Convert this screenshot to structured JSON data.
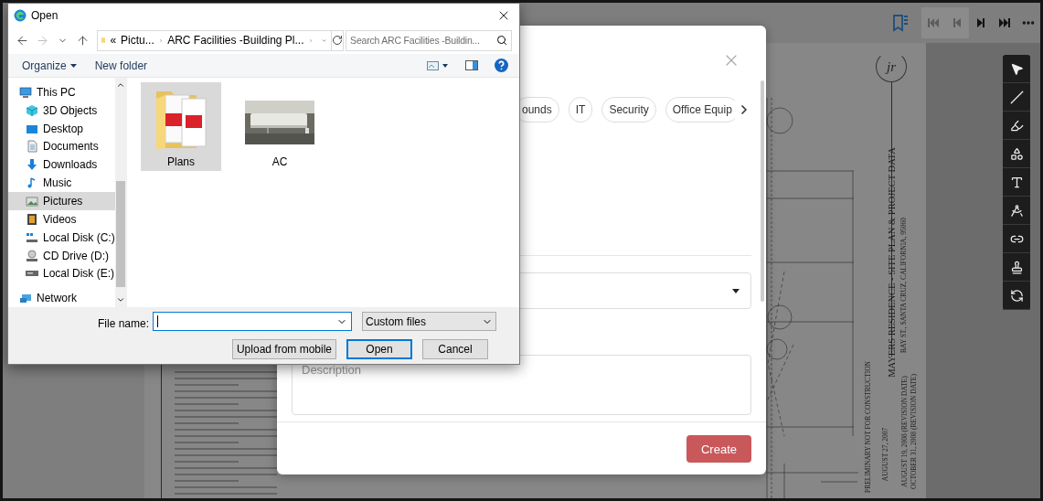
{
  "viewer": {
    "nav": [
      {
        "kind": "bookmarks",
        "disabled": false
      },
      {
        "kind": "first",
        "disabled": true
      },
      {
        "kind": "previous",
        "disabled": true
      },
      {
        "kind": "next",
        "disabled": false
      },
      {
        "kind": "last",
        "disabled": false
      },
      {
        "kind": "more",
        "disabled": false
      }
    ],
    "tools": [
      {
        "kind": "select"
      },
      {
        "kind": "line"
      },
      {
        "kind": "pen"
      },
      {
        "kind": "shapes"
      },
      {
        "kind": "text"
      },
      {
        "kind": "compass"
      },
      {
        "kind": "link"
      },
      {
        "kind": "stamp"
      },
      {
        "kind": "rotate"
      }
    ]
  },
  "sheet": {
    "logo": "jr",
    "title": "MAYERS RESIDENCE - SITE PLAN & PROJECT DATA",
    "subtitle": "BAY ST., SANTA CRUZ, CALIFORNIA, 95060",
    "stamp": "PRELIMINARY NOT FOR CONSTRUCTION",
    "date": "AUGUST 27, 2007",
    "revisions": [
      "AUGUST 19, 2008 (REVISION DATE)",
      "OCTOBER 31, 2008 (REVISION DATE)"
    ]
  },
  "modal": {
    "categories": [
      {
        "label": "ounds",
        "selected": false
      },
      {
        "label": "IT",
        "selected": false
      },
      {
        "label": "Security",
        "selected": false
      },
      {
        "label": "Office Equip",
        "selected": false
      }
    ],
    "description": {
      "placeholder": "Description"
    },
    "create_label": "Create"
  },
  "file_dialog": {
    "title": "Open",
    "path_overflow": "«",
    "path": [
      "Pictu...",
      "ARC Facilities -Building Pl..."
    ],
    "search": {
      "placeholder": "Search ARC Facilities -Buildin..."
    },
    "commands": [
      {
        "label": "Organize",
        "menu": true
      },
      {
        "label": "New folder",
        "menu": false
      }
    ],
    "nav": [
      {
        "label": "This PC",
        "kind": "pc",
        "selected": false,
        "children": [
          {
            "label": "3D Objects",
            "kind": "cube",
            "selected": false
          },
          {
            "label": "Desktop",
            "kind": "desktop",
            "selected": false
          },
          {
            "label": "Documents",
            "kind": "documents",
            "selected": false
          },
          {
            "label": "Downloads",
            "kind": "downloads",
            "selected": false
          },
          {
            "label": "Music",
            "kind": "music",
            "selected": false
          },
          {
            "label": "Pictures",
            "kind": "pictures",
            "selected": true
          },
          {
            "label": "Videos",
            "kind": "videos",
            "selected": false
          },
          {
            "label": "Local Disk (C:)",
            "kind": "system-disk",
            "selected": false
          },
          {
            "label": "CD Drive (D:)",
            "kind": "cd",
            "selected": false
          },
          {
            "label": "Local Disk (E:)",
            "kind": "disk",
            "selected": false
          }
        ]
      },
      {
        "label": "Network",
        "kind": "network",
        "selected": false
      }
    ],
    "items": [
      {
        "name": "Plans",
        "kind": "folder",
        "selected": true
      },
      {
        "name": "AC",
        "kind": "picture",
        "selected": false
      }
    ],
    "file_name_label": "File name:",
    "file_type": "Custom files",
    "buttons": [
      {
        "label": "Upload from mobile",
        "default": false
      },
      {
        "label": "Open",
        "default": true
      },
      {
        "label": "Cancel",
        "default": false
      }
    ]
  }
}
